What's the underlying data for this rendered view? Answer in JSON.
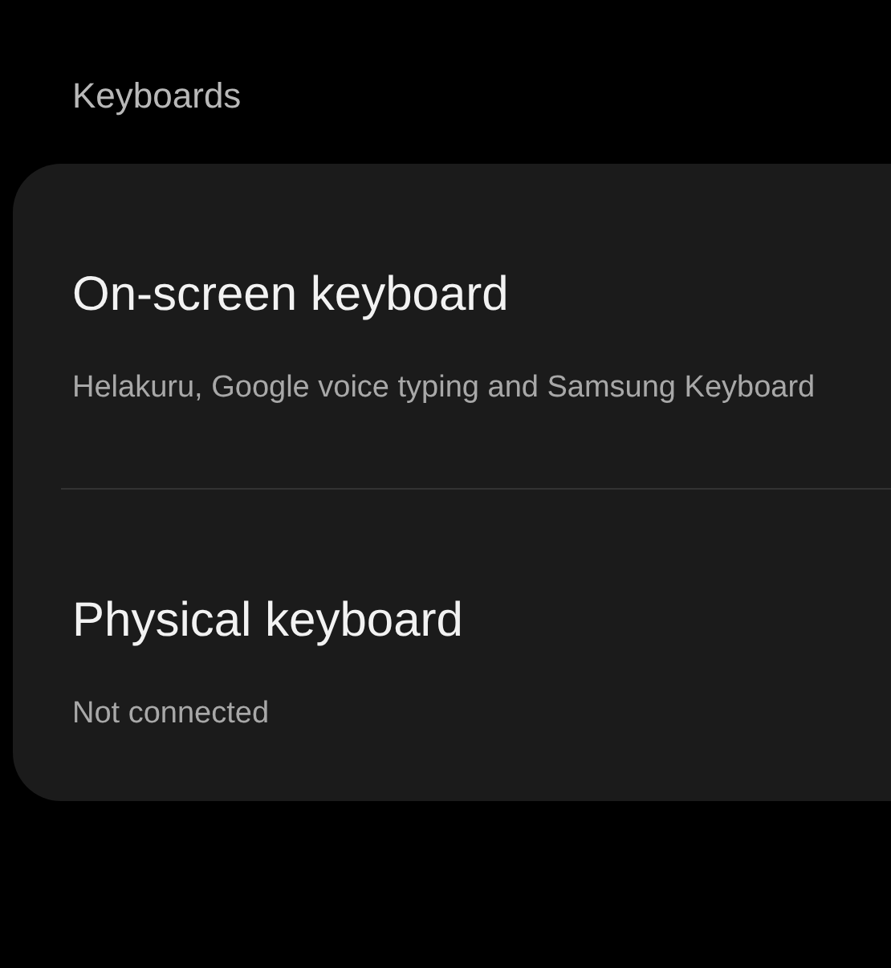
{
  "section_title": "Keyboards",
  "items": [
    {
      "title": "On-screen keyboard",
      "subtitle": "Helakuru, Google voice typing and Samsung Keyboard"
    },
    {
      "title": "Physical keyboard",
      "subtitle": "Not connected"
    }
  ]
}
